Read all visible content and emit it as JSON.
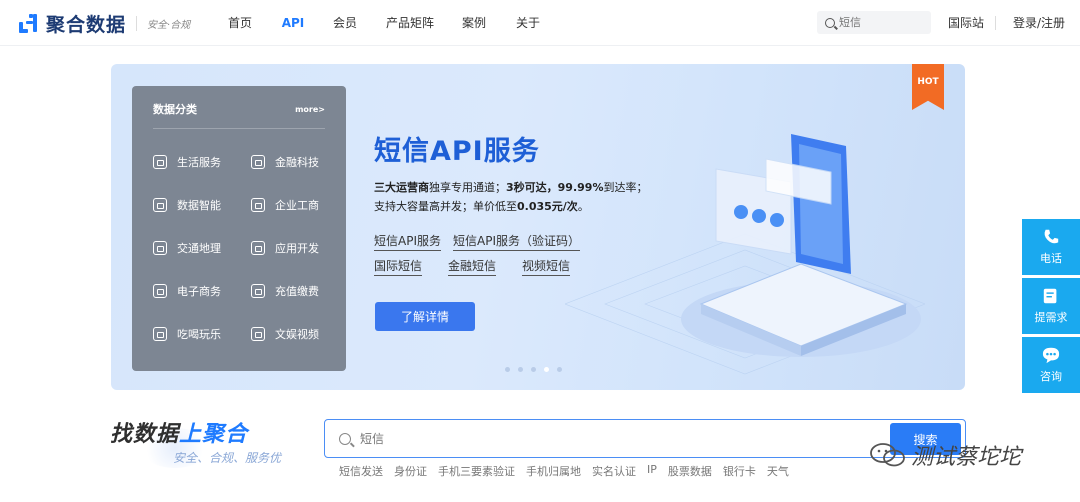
{
  "header": {
    "brand": "聚合数据",
    "slogan": "安全·合规",
    "nav": [
      {
        "label": "首页",
        "active": false
      },
      {
        "label": "API",
        "active": true
      },
      {
        "label": "会员",
        "active": false
      },
      {
        "label": "产品矩阵",
        "active": false
      },
      {
        "label": "案例",
        "active": false
      },
      {
        "label": "关于",
        "active": false
      }
    ],
    "search_placeholder": "短信",
    "intl_label": "国际站",
    "login_label": "登录/注册"
  },
  "banner": {
    "category": {
      "title": "数据分类",
      "more": "more>",
      "items": [
        "生活服务",
        "金融科技",
        "数据智能",
        "企业工商",
        "交通地理",
        "应用开发",
        "电子商务",
        "充值缴费",
        "吃喝玩乐",
        "文娱视频"
      ]
    },
    "hot_badge": "HOT",
    "title": "短信API服务",
    "desc_line1_bold1": "三大运营商",
    "desc_line1_text1": "独享专用通道；",
    "desc_line1_bold2": "3秒可达，99.99%",
    "desc_line1_text2": "到达率；",
    "desc_line2_text": "支持大容量高并发；单价低至",
    "desc_line2_bold": "0.035元/次",
    "desc_line2_end": "。",
    "links": [
      "短信API服务",
      "短信API服务（验证码）",
      "国际短信",
      "金融短信",
      "视频短信"
    ],
    "cta": "了解详情",
    "slides": 5,
    "active_slide": 4
  },
  "side": [
    {
      "label": "电话",
      "icon": "phone-icon"
    },
    {
      "label": "提需求",
      "icon": "edit-icon"
    },
    {
      "label": "咨询",
      "icon": "chat-icon"
    }
  ],
  "search": {
    "slogan_main_a": "找数据",
    "slogan_main_b": "上聚合",
    "slogan_sub": "安全、合规、服务优",
    "placeholder": "短信",
    "button": "搜索",
    "hot_words": [
      "短信发送",
      "身份证",
      "手机三要素验证",
      "手机归属地",
      "实名认证",
      "IP",
      "股票数据",
      "银行卡",
      "天气"
    ]
  },
  "watermark": "测试蔡坨坨",
  "colors": {
    "accent": "#1f7bff",
    "hot": "#f26b24",
    "side": "#1aa9ef"
  }
}
